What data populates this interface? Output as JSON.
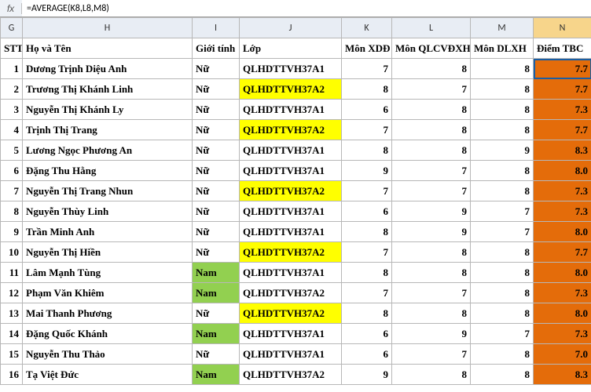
{
  "formula_bar": {
    "fx_label": "fx",
    "value": "=AVERAGE(K8,L8,M8)"
  },
  "columns": {
    "letters": [
      "G",
      "H",
      "I",
      "J",
      "K",
      "L",
      "M",
      "N"
    ],
    "selected": "N"
  },
  "headers": {
    "stt": "STT",
    "name": "Họ và Tên",
    "gender": "Giới tính",
    "class": "Lớp",
    "score1": "Môn XDĐ",
    "score2": "Môn QLCVĐXH",
    "score3": "Môn DLXH",
    "tbc": "Điểm TBC"
  },
  "rows": [
    {
      "stt": "1",
      "name": "Dương Trịnh Diệu Anh",
      "gender": "Nữ",
      "class": "QLHDTTVH37A1",
      "s1": "7",
      "s2": "8",
      "s3": "8",
      "tbc": "7.7",
      "class_hl": false,
      "gender_hl": false,
      "tbc_selected": true
    },
    {
      "stt": "2",
      "name": "Trương Thị Khánh Linh",
      "gender": "Nữ",
      "class": "QLHDTTVH37A2",
      "s1": "8",
      "s2": "7",
      "s3": "8",
      "tbc": "7.7",
      "class_hl": true,
      "gender_hl": false
    },
    {
      "stt": "3",
      "name": "Nguyễn Thị Khánh Ly",
      "gender": "Nữ",
      "class": "QLHDTTVH37A1",
      "s1": "6",
      "s2": "8",
      "s3": "8",
      "tbc": "7.3",
      "class_hl": false,
      "gender_hl": false
    },
    {
      "stt": "4",
      "name": "Trịnh Thị Trang",
      "gender": "Nữ",
      "class": "QLHDTTVH37A2",
      "s1": "7",
      "s2": "8",
      "s3": "8",
      "tbc": "7.7",
      "class_hl": true,
      "gender_hl": false
    },
    {
      "stt": "5",
      "name": "Lương Ngọc Phương An",
      "gender": "Nữ",
      "class": "QLHDTTVH37A1",
      "s1": "8",
      "s2": "8",
      "s3": "9",
      "tbc": "8.3",
      "class_hl": false,
      "gender_hl": false
    },
    {
      "stt": "6",
      "name": "Đặng Thu Hằng",
      "gender": "Nữ",
      "class": "QLHDTTVH37A1",
      "s1": "9",
      "s2": "7",
      "s3": "8",
      "tbc": "8.0",
      "class_hl": false,
      "gender_hl": false
    },
    {
      "stt": "7",
      "name": "Nguyễn Thị Trang Nhun",
      "gender": "Nữ",
      "class": "QLHDTTVH37A2",
      "s1": "7",
      "s2": "7",
      "s3": "8",
      "tbc": "7.3",
      "class_hl": true,
      "gender_hl": false
    },
    {
      "stt": "8",
      "name": "Nguyễn Thùy Linh",
      "gender": "Nữ",
      "class": "QLHDTTVH37A1",
      "s1": "6",
      "s2": "9",
      "s3": "7",
      "tbc": "7.3",
      "class_hl": false,
      "gender_hl": false
    },
    {
      "stt": "9",
      "name": "Trần Minh Anh",
      "gender": "Nữ",
      "class": "QLHDTTVH37A1",
      "s1": "8",
      "s2": "9",
      "s3": "7",
      "tbc": "8.0",
      "class_hl": false,
      "gender_hl": false
    },
    {
      "stt": "10",
      "name": "Nguyễn Thị Hiền",
      "gender": "Nữ",
      "class": "QLHDTTVH37A2",
      "s1": "7",
      "s2": "8",
      "s3": "8",
      "tbc": "7.7",
      "class_hl": true,
      "gender_hl": false
    },
    {
      "stt": "11",
      "name": "Lâm Mạnh Tùng",
      "gender": "Nam",
      "class": "QLHDTTVH37A1",
      "s1": "8",
      "s2": "8",
      "s3": "8",
      "tbc": "8.0",
      "class_hl": false,
      "gender_hl": true
    },
    {
      "stt": "12",
      "name": "Phạm Văn Khiêm",
      "gender": "Nam",
      "class": "QLHDTTVH37A2",
      "s1": "7",
      "s2": "7",
      "s3": "8",
      "tbc": "7.3",
      "class_hl": false,
      "gender_hl": true
    },
    {
      "stt": "13",
      "name": "Mai Thanh Phương",
      "gender": "Nữ",
      "class": "QLHDTTVH37A2",
      "s1": "8",
      "s2": "8",
      "s3": "8",
      "tbc": "8.0",
      "class_hl": true,
      "gender_hl": false
    },
    {
      "stt": "14",
      "name": "Đặng Quốc Khánh",
      "gender": "Nam",
      "class": "QLHDTTVH37A1",
      "s1": "6",
      "s2": "9",
      "s3": "7",
      "tbc": "7.3",
      "class_hl": false,
      "gender_hl": true
    },
    {
      "stt": "15",
      "name": "Nguyễn Thu Thảo",
      "gender": "Nữ",
      "class": "QLHDTTVH37A1",
      "s1": "6",
      "s2": "7",
      "s3": "8",
      "tbc": "7.0",
      "class_hl": false,
      "gender_hl": false
    },
    {
      "stt": "16",
      "name": "Tạ Việt Đức",
      "gender": "Nam",
      "class": "QLHDTTVH37A2",
      "s1": "9",
      "s2": "8",
      "s3": "8",
      "tbc": "8.3",
      "class_hl": false,
      "gender_hl": true
    }
  ],
  "chart_data": {
    "type": "table",
    "columns": [
      "STT",
      "Họ và Tên",
      "Giới tính",
      "Lớp",
      "Môn XDĐ",
      "Môn QLCVĐXH",
      "Môn DLXH",
      "Điểm TBC"
    ],
    "rows": [
      [
        1,
        "Dương Trịnh Diệu Anh",
        "Nữ",
        "QLHDTTVH37A1",
        7,
        8,
        8,
        7.7
      ],
      [
        2,
        "Trương Thị Khánh Linh",
        "Nữ",
        "QLHDTTVH37A2",
        8,
        7,
        8,
        7.7
      ],
      [
        3,
        "Nguyễn Thị Khánh Ly",
        "Nữ",
        "QLHDTTVH37A1",
        6,
        8,
        8,
        7.3
      ],
      [
        4,
        "Trịnh Thị Trang",
        "Nữ",
        "QLHDTTVH37A2",
        7,
        8,
        8,
        7.7
      ],
      [
        5,
        "Lương Ngọc Phương An",
        "Nữ",
        "QLHDTTVH37A1",
        8,
        8,
        9,
        8.3
      ],
      [
        6,
        "Đặng Thu Hằng",
        "Nữ",
        "QLHDTTVH37A1",
        9,
        7,
        8,
        8.0
      ],
      [
        7,
        "Nguyễn Thị Trang Nhun",
        "Nữ",
        "QLHDTTVH37A2",
        7,
        7,
        8,
        7.3
      ],
      [
        8,
        "Nguyễn Thùy Linh",
        "Nữ",
        "QLHDTTVH37A1",
        6,
        9,
        7,
        7.3
      ],
      [
        9,
        "Trần Minh Anh",
        "Nữ",
        "QLHDTTVH37A1",
        8,
        9,
        7,
        8.0
      ],
      [
        10,
        "Nguyễn Thị Hiền",
        "Nữ",
        "QLHDTTVH37A2",
        7,
        8,
        8,
        7.7
      ],
      [
        11,
        "Lâm Mạnh Tùng",
        "Nam",
        "QLHDTTVH37A1",
        8,
        8,
        8,
        8.0
      ],
      [
        12,
        "Phạm Văn Khiêm",
        "Nam",
        "QLHDTTVH37A2",
        7,
        7,
        8,
        7.3
      ],
      [
        13,
        "Mai Thanh Phương",
        "Nữ",
        "QLHDTTVH37A2",
        8,
        8,
        8,
        8.0
      ],
      [
        14,
        "Đặng Quốc Khánh",
        "Nam",
        "QLHDTTVH37A1",
        6,
        9,
        7,
        7.3
      ],
      [
        15,
        "Nguyễn Thu Thảo",
        "Nữ",
        "QLHDTTVH37A1",
        6,
        7,
        8,
        7.0
      ],
      [
        16,
        "Tạ Việt Đức",
        "Nam",
        "QLHDTTVH37A2",
        9,
        8,
        8,
        8.3
      ]
    ]
  }
}
